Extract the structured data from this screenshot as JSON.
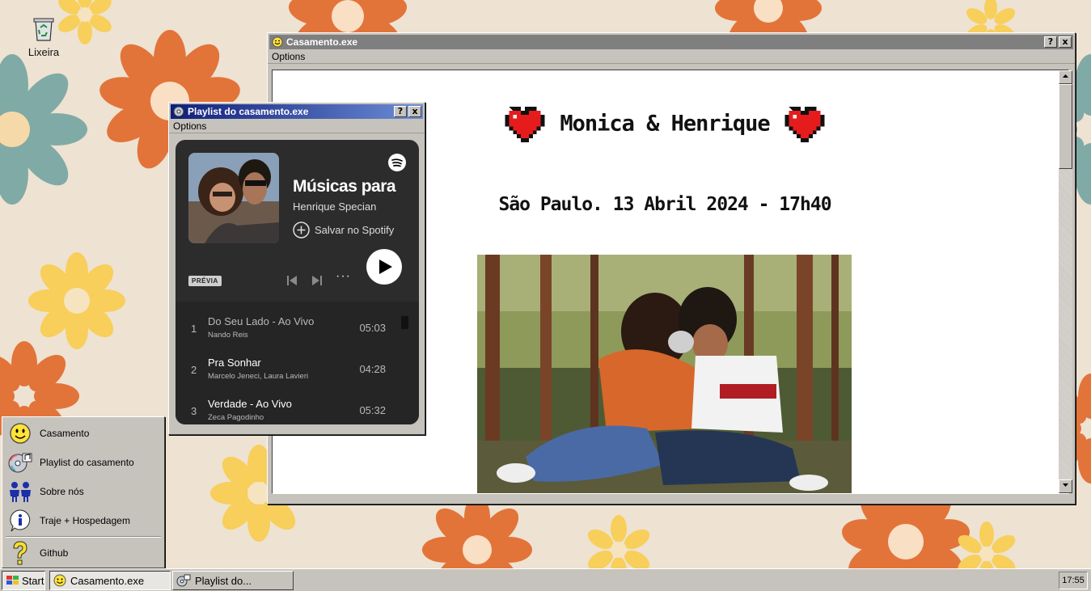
{
  "desktop": {
    "icons": [
      {
        "label": "Lixeira",
        "icon": "recycle-bin-icon"
      }
    ]
  },
  "main_window": {
    "title": "Casamento.exe",
    "menu": "Options",
    "help_label": "?",
    "close_label": "x",
    "heading": "Monica & Henrique",
    "date_line": "São Paulo. 13 Abril 2024 - 17h40"
  },
  "playlist_window": {
    "title": "Playlist do casamento.exe",
    "menu": "Options",
    "help_label": "?",
    "close_label": "x",
    "player": {
      "title": "Músicas para",
      "artist": "Henrique Specian",
      "save_label": "Salvar no Spotify",
      "preview_badge": "PRÉVIA",
      "more_label": "···",
      "tracks": [
        {
          "number": "1",
          "name": "Do Seu Lado - Ao Vivo",
          "artist": "Nando Reis",
          "duration": "05:03"
        },
        {
          "number": "2",
          "name": "Pra Sonhar",
          "artist": "Marcelo Jeneci, Laura Lavieri",
          "duration": "04:28"
        },
        {
          "number": "3",
          "name": "Verdade - Ao Vivo",
          "artist": "Zeca Pagodinho",
          "duration": "05:32"
        }
      ]
    }
  },
  "start_menu": {
    "items": [
      {
        "label": "Casamento",
        "icon": "smiley-icon"
      },
      {
        "label": "Playlist do casamento",
        "icon": "cd-music-icon"
      },
      {
        "label": "Sobre nós",
        "icon": "people-icon"
      },
      {
        "label": "Traje + Hospedagem",
        "icon": "info-icon"
      },
      {
        "label": "Github",
        "icon": "question-icon"
      }
    ]
  },
  "taskbar": {
    "start_label": "Start",
    "buttons": [
      {
        "label": "Casamento.exe",
        "icon": "smiley-icon"
      },
      {
        "label": "Playlist do...",
        "icon": "cd-music-icon"
      }
    ],
    "clock": "17:55"
  },
  "colors": {
    "wallpaper": "#eee2d2",
    "flower_orange": "#e2743a",
    "flower_yellow": "#f7cf5a",
    "flower_teal": "#80aaa6",
    "window_face": "#c6c3bd",
    "active_title": "#0f1e7a",
    "inactive_title": "#7f7f7f",
    "spotify_card": "#2c2c2c"
  }
}
